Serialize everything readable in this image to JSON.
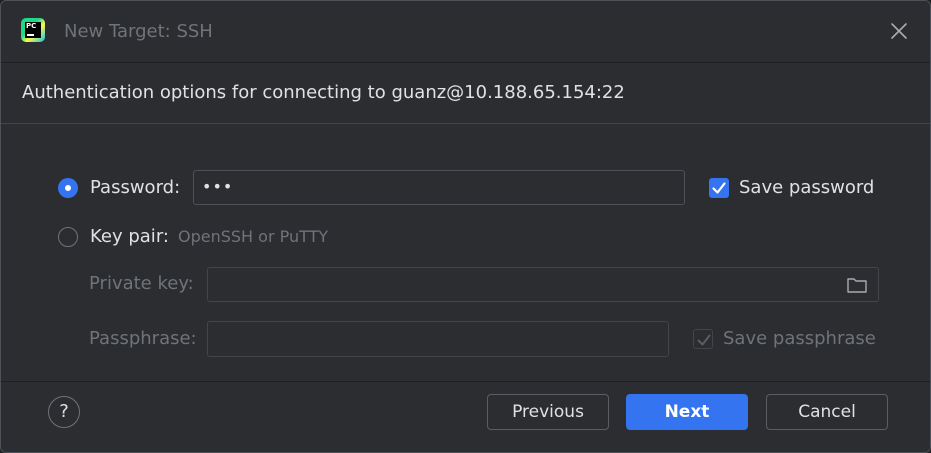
{
  "window": {
    "title": "New Target: SSH",
    "app_icon_text": "PC"
  },
  "header": {
    "subtitle": "Authentication options for connecting to guanz@10.188.65.154:22"
  },
  "auth": {
    "password_option": {
      "label": "Password:",
      "selected": true,
      "value": "•••",
      "save_label": "Save password",
      "save_checked": true
    },
    "keypair_option": {
      "label": "Key pair:",
      "hint": "OpenSSH or PuTTY",
      "selected": false
    },
    "private_key": {
      "label": "Private key:",
      "value": "",
      "enabled": false
    },
    "passphrase": {
      "label": "Passphrase:",
      "value": "",
      "enabled": false,
      "save_label": "Save passphrase",
      "save_checked": true
    }
  },
  "footer": {
    "help_label": "?",
    "previous_label": "Previous",
    "next_label": "Next",
    "cancel_label": "Cancel"
  },
  "colors": {
    "accent": "#3574f0",
    "background": "#2b2d30",
    "text": "#dfe1e5",
    "disabled_text": "#6f737a"
  },
  "icons": {
    "app": "pycharm-icon",
    "close": "close-icon",
    "folder": "folder-icon",
    "help": "help-icon",
    "check": "checkmark-icon"
  }
}
